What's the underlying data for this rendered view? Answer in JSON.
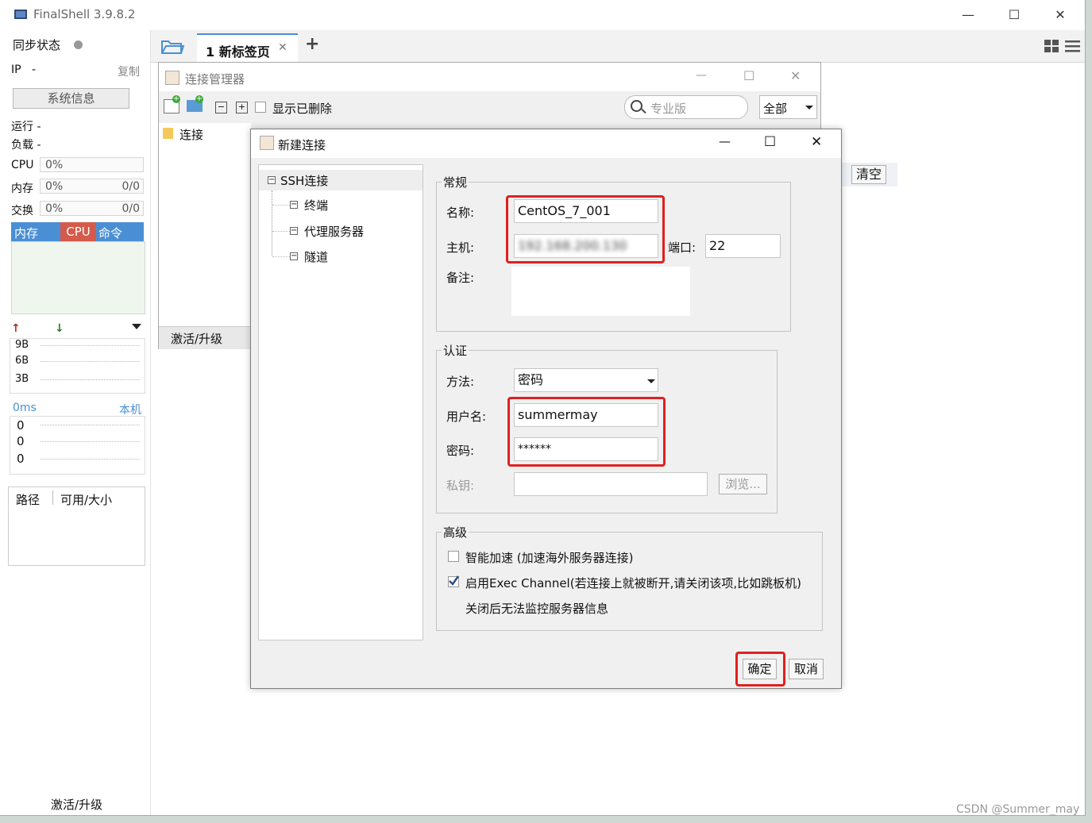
{
  "app": {
    "title": "FinalShell 3.9.8.2"
  },
  "left": {
    "sync_label": "同步状态",
    "ip_label": "IP",
    "ip_value": "-",
    "copy": "复制",
    "sysinfo_button": "系统信息",
    "run_label": "运行 -",
    "load_label": "负载 -",
    "cpu_label": "CPU",
    "cpu_value": "0%",
    "mem_label": "内存",
    "mem_value": "0%",
    "mem_ratio": "0/0",
    "swap_label": "交换",
    "swap_value": "0%",
    "swap_ratio": "0/0",
    "tabs": [
      "内存",
      "CPU",
      "命令"
    ],
    "net_ticks": [
      "9B",
      "6B",
      "3B"
    ],
    "latency": "0ms",
    "latency_host": "本机",
    "latency_values": [
      "0",
      "0",
      "0"
    ],
    "disk_cols": [
      "路径",
      "可用/大小"
    ],
    "activate": "激活/升级"
  },
  "tabbar": {
    "tab_label": "1 新标签页",
    "add": "+"
  },
  "connmgr": {
    "title": "连接管理器",
    "show_deleted": "显示已删除",
    "search_placeholder": "专业版",
    "filter_value": "全部",
    "folder": "连接",
    "activate": "激活/升级",
    "clear_button": "清空"
  },
  "dialog": {
    "title": "新建连接",
    "tree": {
      "root": "SSH连接",
      "children": [
        "终端",
        "代理服务器",
        "隧道"
      ]
    },
    "general": {
      "legend": "常规",
      "name_label": "名称:",
      "name_value": "CentOS_7_001",
      "host_label": "主机:",
      "host_value": "192.168.200.130",
      "port_label": "端口:",
      "port_value": "22",
      "note_label": "备注:"
    },
    "auth": {
      "legend": "认证",
      "method_label": "方法:",
      "method_value": "密码",
      "user_label": "用户名:",
      "user_value": "summermay",
      "pass_label": "密码:",
      "pass_value": "******",
      "key_label": "私钥:",
      "browse": "浏览..."
    },
    "advanced": {
      "legend": "高级",
      "smart_accel": "智能加速 (加速海外服务器连接)",
      "exec_channel": "启用Exec Channel(若连接上就被断开,请关闭该项,比如跳板机)",
      "exec_note": "关闭后无法监控服务器信息",
      "smart_accel_checked": false,
      "exec_channel_checked": true
    },
    "ok": "确定",
    "cancel": "取消"
  },
  "watermark": "CSDN @Summer_may",
  "colors": {
    "accent_blue": "#4a8fd4",
    "cpu_tab": "#d45b4b",
    "highlight_red": "#e02020"
  }
}
